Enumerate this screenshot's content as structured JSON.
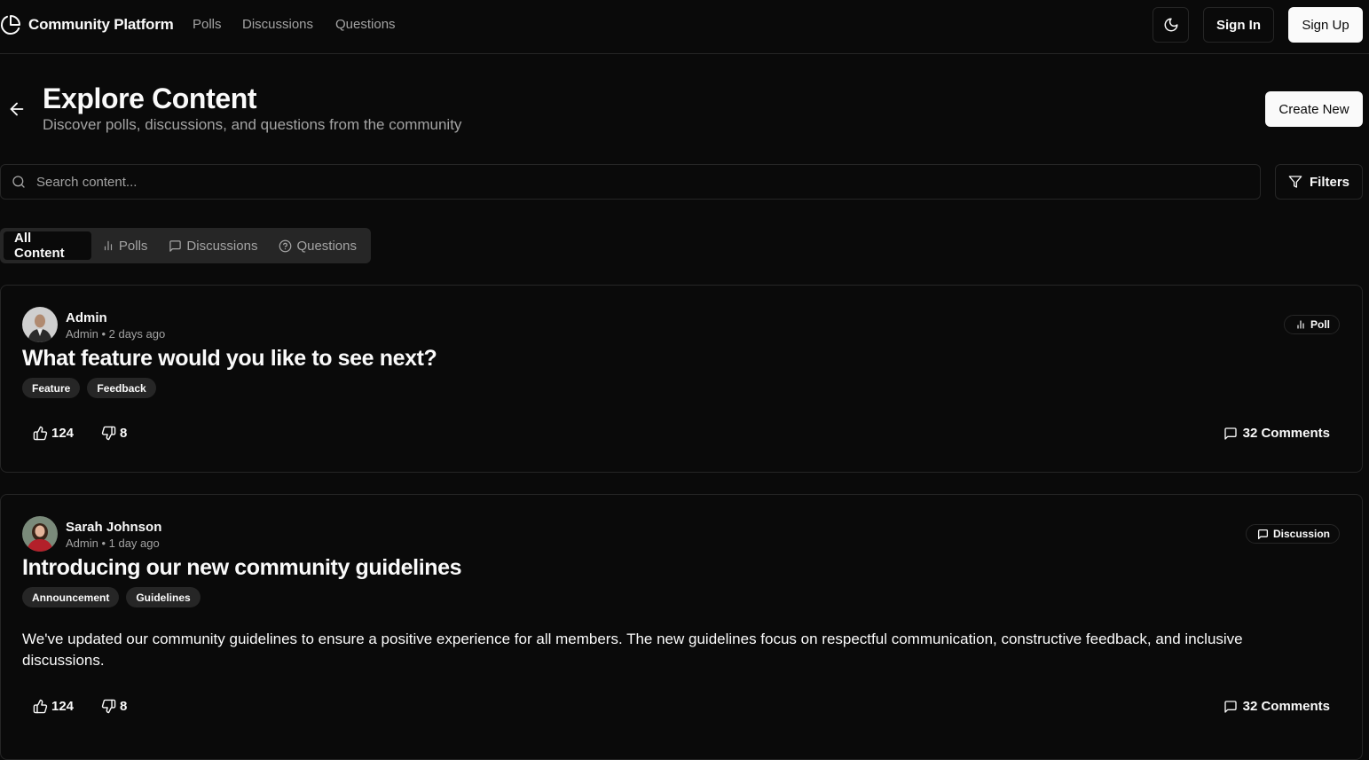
{
  "nav": {
    "brand": "Community Platform",
    "links": [
      "Polls",
      "Discussions",
      "Questions"
    ],
    "theme_icon": "moon-icon",
    "sign_in": "Sign In",
    "sign_up": "Sign Up"
  },
  "header": {
    "title": "Explore Content",
    "subtitle": "Discover polls, discussions, and questions from the community",
    "create_button": "Create New"
  },
  "search": {
    "placeholder": "Search content...",
    "value": "",
    "filters_button": "Filters"
  },
  "tabs": [
    {
      "label": "All Content",
      "icon": "",
      "active": true
    },
    {
      "label": "Polls",
      "icon": "bar-chart-icon",
      "active": false
    },
    {
      "label": "Discussions",
      "icon": "message-square-icon",
      "active": false
    },
    {
      "label": "Questions",
      "icon": "help-circle-icon",
      "active": false
    }
  ],
  "posts": [
    {
      "author": "Admin",
      "role": "Admin",
      "time": "2 days ago",
      "meta": "Admin • 2 days ago",
      "type": "Poll",
      "type_icon": "bar-chart-icon",
      "title": "What feature would you like to see next?",
      "tags": [
        "Feature",
        "Feedback"
      ],
      "body": "",
      "likes": "124",
      "dislikes": "8",
      "comments": "32 Comments"
    },
    {
      "author": "Sarah Johnson",
      "role": "Admin",
      "time": "1 day ago",
      "meta": "Admin • 1 day ago",
      "type": "Discussion",
      "type_icon": "message-square-icon",
      "title": "Introducing our new community guidelines",
      "tags": [
        "Announcement",
        "Guidelines"
      ],
      "body": "We've updated our community guidelines to ensure a positive experience for all members. The new guidelines focus on respectful communication, constructive feedback, and inclusive discussions.",
      "likes": "124",
      "dislikes": "8",
      "comments": "32 Comments"
    }
  ],
  "colors": {
    "background": "#0a0a0a",
    "foreground": "#fafafa",
    "muted": "#a3a3a3",
    "border": "#262626"
  }
}
